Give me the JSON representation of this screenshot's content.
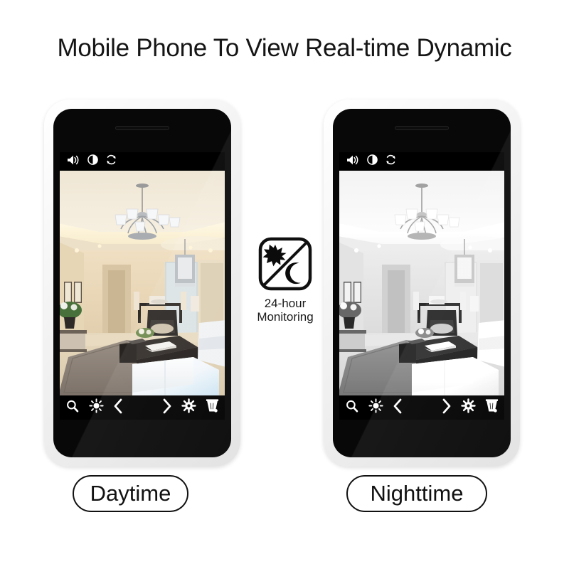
{
  "page": {
    "title": "Mobile Phone To View Real-time Dynamic",
    "background_color": "#ffffff"
  },
  "badge": {
    "icon_name": "day-night-24h-icon",
    "caption_line1": "24-hour",
    "caption_line2": "Monitoring",
    "sun_icon": "sun-star-icon",
    "moon_icon": "crescent-moon-icon"
  },
  "phones": [
    {
      "id": "left",
      "caption": "Daytime",
      "mode": "day",
      "frame_color": "#f1f1f1",
      "body_color": "#080808",
      "top_toolbar": [
        {
          "name": "volume-icon",
          "label": "Volume"
        },
        {
          "name": "contrast-icon",
          "label": "Contrast"
        },
        {
          "name": "refresh-icon",
          "label": "Refresh"
        }
      ],
      "bottom_toolbar": [
        {
          "name": "search-icon",
          "label": "Zoom"
        },
        {
          "name": "brightness-icon",
          "label": "Brightness"
        },
        {
          "name": "chevron-left-icon",
          "label": "Previous"
        },
        {
          "name": "chevron-right-icon",
          "label": "Next"
        },
        {
          "name": "settings-gear-icon",
          "label": "Settings"
        },
        {
          "name": "trash-icon",
          "label": "Delete"
        }
      ]
    },
    {
      "id": "right",
      "caption": "Nighttime",
      "mode": "night",
      "frame_color": "#f1f1f1",
      "body_color": "#080808",
      "top_toolbar": [
        {
          "name": "volume-icon",
          "label": "Volume"
        },
        {
          "name": "contrast-icon",
          "label": "Contrast"
        },
        {
          "name": "refresh-icon",
          "label": "Refresh"
        }
      ],
      "bottom_toolbar": [
        {
          "name": "search-icon",
          "label": "Zoom"
        },
        {
          "name": "brightness-icon",
          "label": "Brightness"
        },
        {
          "name": "chevron-left-icon",
          "label": "Previous"
        },
        {
          "name": "chevron-right-icon",
          "label": "Next"
        },
        {
          "name": "settings-gear-icon",
          "label": "Settings"
        },
        {
          "name": "trash-icon",
          "label": "Delete"
        }
      ]
    }
  ],
  "camera_view": {
    "scene": "living room with chandelier, coffee table, sofa and dining area",
    "day_palette": {
      "ceiling": "#f3ead9",
      "cove_light": "#fff6de",
      "wall": "#e8d9bf",
      "floor": "#ddceb4",
      "rug": "#8d8279",
      "table": "#2b2724",
      "sofa": "#f2f4f6",
      "accent": "#cfe6f4"
    },
    "night_filter": "grayscale"
  }
}
